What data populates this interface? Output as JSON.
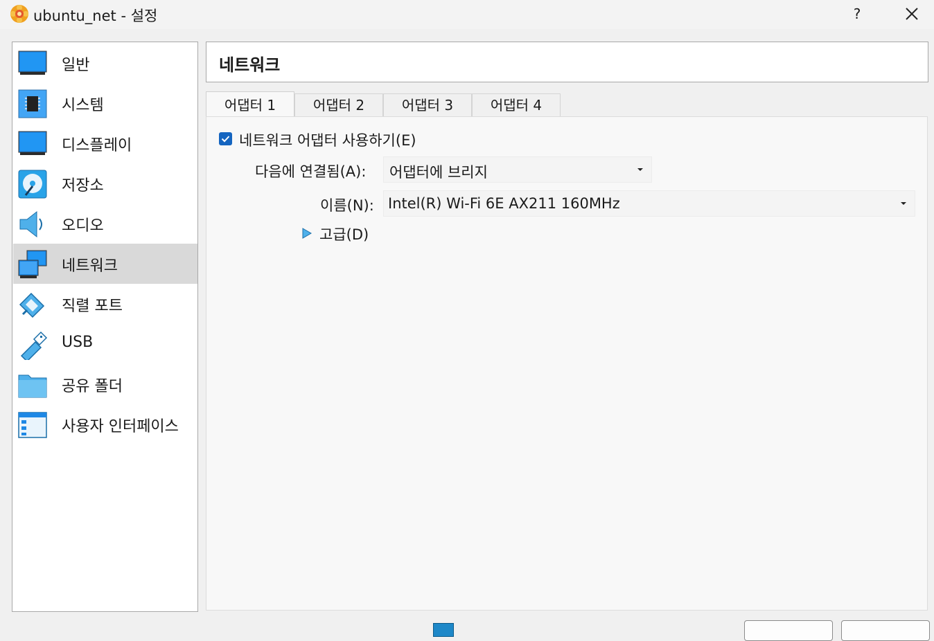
{
  "window": {
    "title": "ubuntu_net - 설정",
    "help_label": "?"
  },
  "sidebar": {
    "items": [
      {
        "label": "일반",
        "icon": "general-icon"
      },
      {
        "label": "시스템",
        "icon": "system-icon"
      },
      {
        "label": "디스플레이",
        "icon": "display-icon"
      },
      {
        "label": "저장소",
        "icon": "storage-icon"
      },
      {
        "label": "오디오",
        "icon": "audio-icon"
      },
      {
        "label": "네트워크",
        "icon": "network-icon",
        "selected": true
      },
      {
        "label": "직렬 포트",
        "icon": "serial-port-icon"
      },
      {
        "label": "USB",
        "icon": "usb-icon"
      },
      {
        "label": "공유 폴더",
        "icon": "shared-folder-icon"
      },
      {
        "label": "사용자 인터페이스",
        "icon": "user-interface-icon"
      }
    ]
  },
  "page": {
    "title": "네트워크"
  },
  "tabs": [
    {
      "label": "어댑터 1",
      "active": true
    },
    {
      "label": "어댑터 2"
    },
    {
      "label": "어댑터 3"
    },
    {
      "label": "어댑터 4"
    }
  ],
  "adapter": {
    "enable_label": "네트워크 어댑터 사용하기(E)",
    "enabled": true,
    "attached_label": "다음에 연결됨(A):",
    "attached_value": "어댑터에 브리지",
    "name_label": "이름(N):",
    "name_value": "Intel(R) Wi-Fi 6E AX211 160MHz",
    "advanced_label": "고급(D)"
  },
  "colors": {
    "accent": "#1565c0",
    "selected_bg": "#d9d9d9",
    "icon_blue": "#1e88c8"
  }
}
